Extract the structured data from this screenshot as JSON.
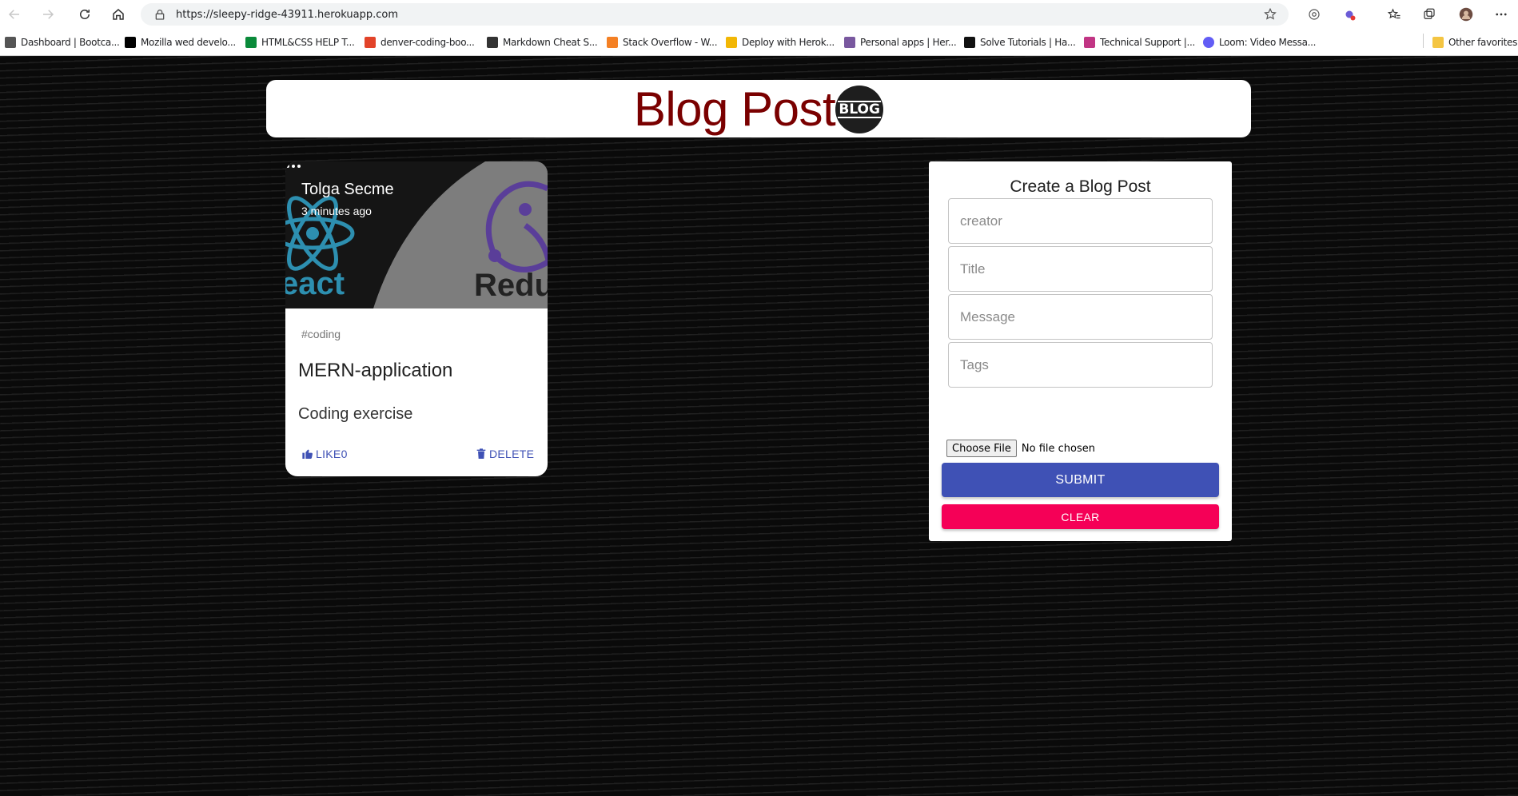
{
  "browser": {
    "url": "https://sleepy-ridge-43911.herokuapp.com",
    "bookmarks": [
      {
        "label": "Dashboard | Bootca...",
        "color": "#555555"
      },
      {
        "label": "Mozilla wed develo...",
        "color": "#000000"
      },
      {
        "label": "HTML&CSS HELP T...",
        "color": "#0a8a3a"
      },
      {
        "label": "denver-coding-boo...",
        "color": "#e24329"
      },
      {
        "label": "Markdown Cheat S...",
        "color": "#333333"
      },
      {
        "label": "Stack Overflow - W...",
        "color": "#f48024"
      },
      {
        "label": "Deploy with Herok...",
        "color": "#f2b705"
      },
      {
        "label": "Personal apps | Her...",
        "color": "#79589f"
      },
      {
        "label": "Solve Tutorials | Ha...",
        "color": "#111111"
      },
      {
        "label": "Technical Support |...",
        "color": "#c13584"
      },
      {
        "label": "Loom: Video Messa...",
        "color": "#625df5"
      }
    ],
    "other_favorites": "Other favorites"
  },
  "header": {
    "title": "Blog Post",
    "logo_text": "BLOG"
  },
  "post": {
    "creator": "Tolga Secme",
    "created_at": "3 minutes ago",
    "tags": "#coding",
    "title": "MERN-application",
    "message": "Coding exercise",
    "like_label": "LIKE",
    "like_count": "0",
    "delete_label": "DELETE",
    "image_texts": {
      "react": "eact",
      "redux": "Redu"
    }
  },
  "form": {
    "title": "Create a Blog Post",
    "creator_placeholder": "creator",
    "title_placeholder": "Title",
    "message_placeholder": "Message",
    "tags_placeholder": "Tags",
    "choose_file_label": "Choose File",
    "file_status": "No file chosen",
    "submit_label": "SUBMIT",
    "clear_label": "CLEAR"
  },
  "colors": {
    "header_title": "#7a0000",
    "primary": "#3f51b5",
    "secondary": "#f50057"
  }
}
